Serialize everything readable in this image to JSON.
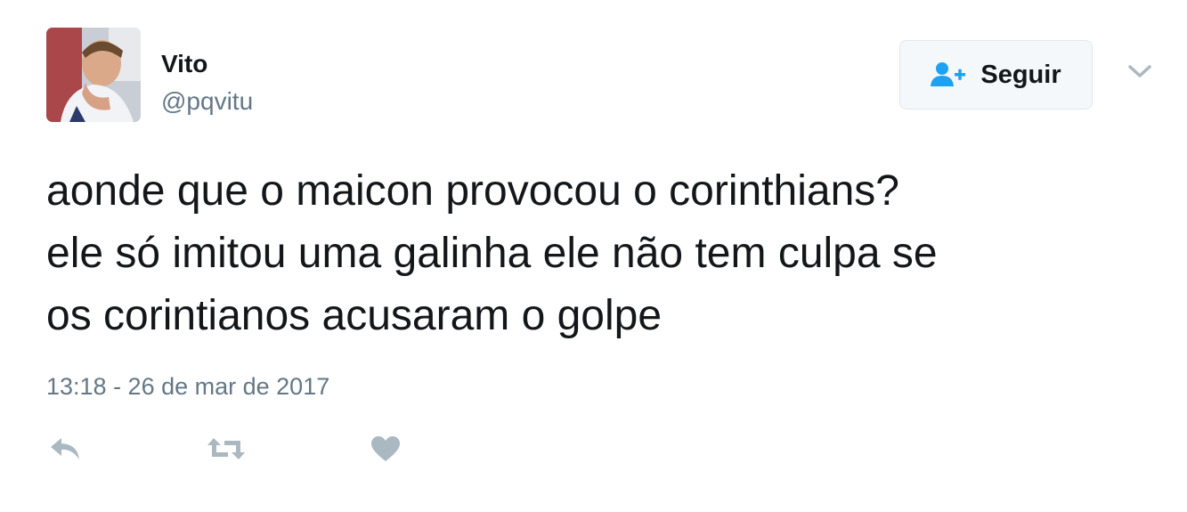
{
  "user": {
    "name": "Vito",
    "handle": "@pqvitu"
  },
  "follow_button": {
    "label": "Seguir",
    "icon": "add-user-icon"
  },
  "menu": {
    "icon": "chevron-down-icon"
  },
  "tweet": {
    "lines": [
      "aonde que o maicon provocou o corinthians?",
      "ele só imitou uma galinha ele não tem culpa se",
      "os corintianos acusaram o golpe"
    ],
    "timestamp": "13:18 - 26 de mar de 2017"
  },
  "actions": [
    {
      "icon": "reply-icon"
    },
    {
      "icon": "retweet-icon"
    },
    {
      "icon": "heart-icon"
    }
  ],
  "colors": {
    "text": "#14171a",
    "muted": "#657786",
    "icon": "#aab8c2",
    "accent": "#1da1f2",
    "button_bg": "#f5f8fa"
  }
}
